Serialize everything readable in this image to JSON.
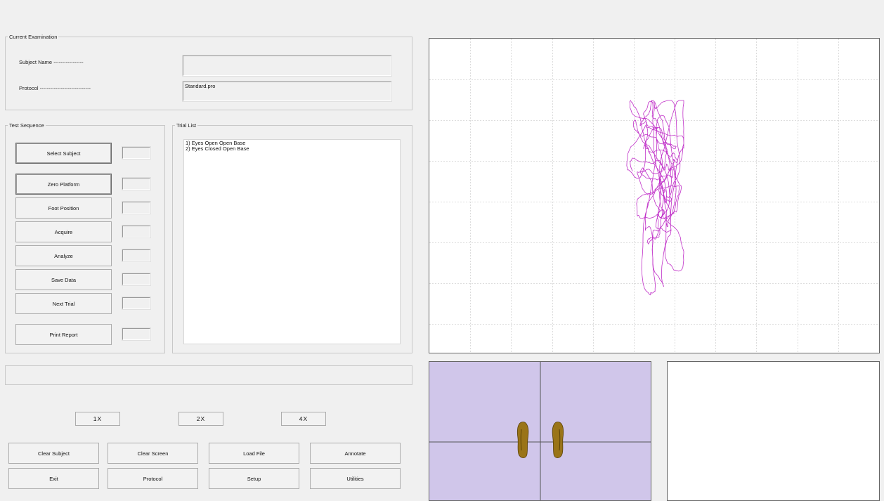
{
  "current_examination": {
    "legend": "Current Examination",
    "subject_label": "Subject Name -----------------",
    "subject_value": "",
    "protocol_label": "Protocol -----------------------------",
    "protocol_value": "Standard.pro"
  },
  "test_sequence": {
    "legend": "Test Sequence",
    "buttons": [
      {
        "label": "Select Subject",
        "status": ""
      },
      {
        "label": "Zero Platform",
        "status": ""
      },
      {
        "label": "Foot Position",
        "status": ""
      },
      {
        "label": "Acquire",
        "status": ""
      },
      {
        "label": "Analyze",
        "status": ""
      },
      {
        "label": "Save Data",
        "status": ""
      },
      {
        "label": "Next Trial",
        "status": ""
      },
      {
        "label": "Print Report",
        "status": ""
      }
    ]
  },
  "trial_list": {
    "legend": "Trial List",
    "items": [
      "1) Eyes Open Open Base",
      "2) Eyes Closed Open Base"
    ]
  },
  "status_bar_text": "",
  "zoom_buttons": [
    "1X",
    "2X",
    "4X"
  ],
  "bottom_buttons": {
    "row1": [
      "Clear Subject",
      "Clear Screen",
      "Load File",
      "Annotate"
    ],
    "row2": [
      "Exit",
      "Protocol",
      "Setup",
      "Utilities"
    ]
  },
  "colors": {
    "trace": "#c030c8",
    "grid": "#d4d4d4",
    "foot_panel_bg": "#d0c6ea",
    "foot": "#9a7418"
  },
  "icons": {
    "left_foot": "left-foot-icon",
    "right_foot": "right-foot-icon"
  }
}
